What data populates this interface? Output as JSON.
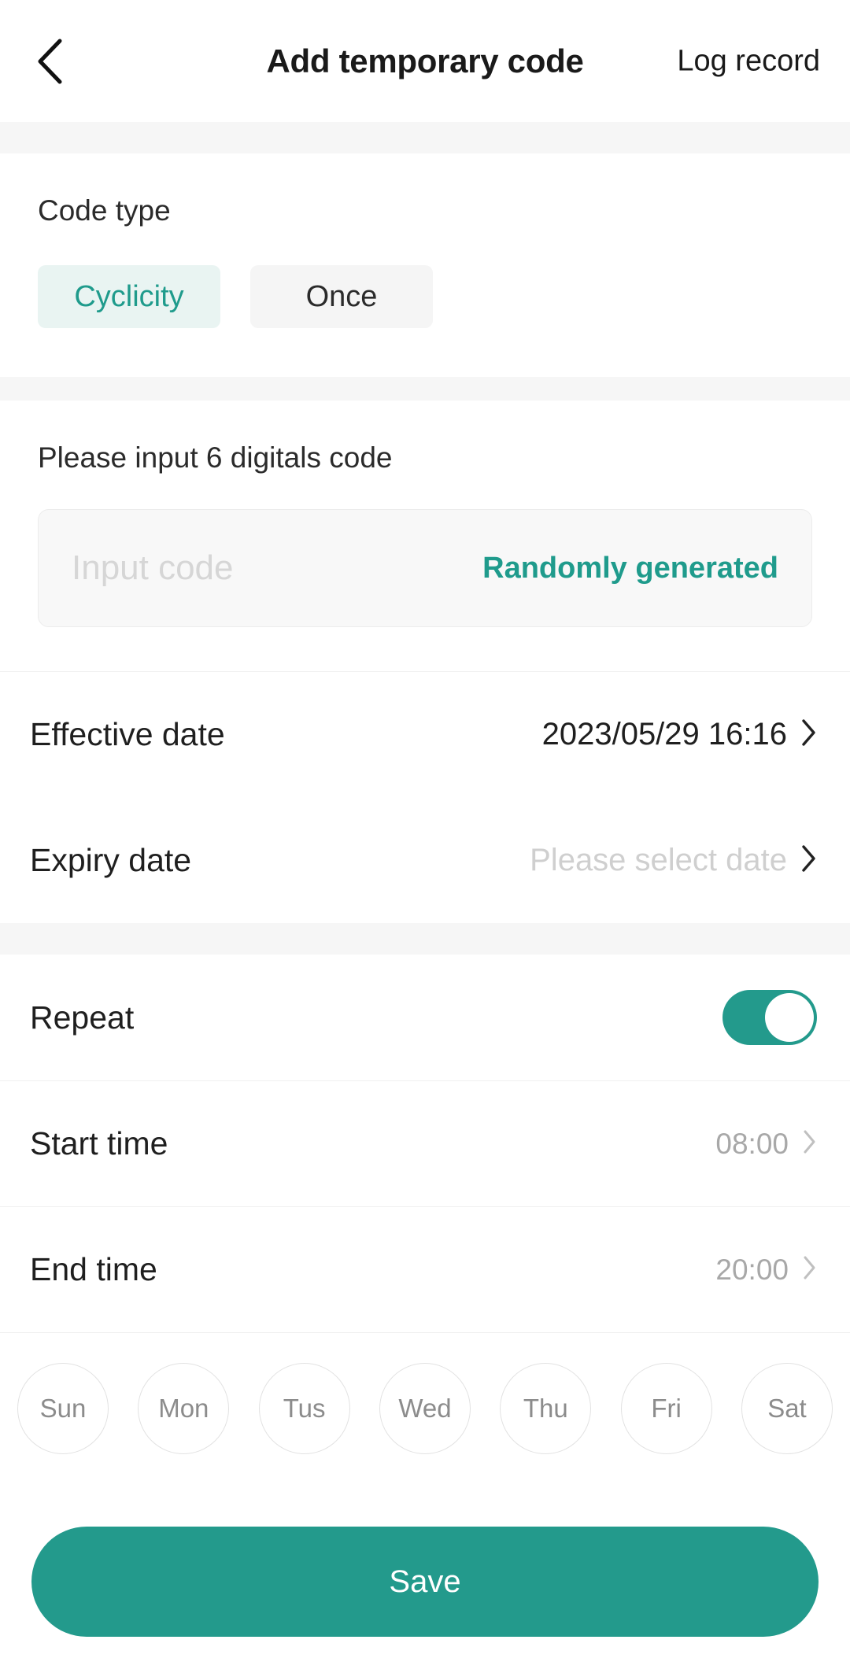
{
  "header": {
    "back_icon": "chevron-left-icon",
    "title": "Add temporary code",
    "action_label": "Log record"
  },
  "code_type": {
    "label": "Code type",
    "options": [
      {
        "label": "Cyclicity",
        "selected": true
      },
      {
        "label": "Once",
        "selected": false
      }
    ]
  },
  "code_input": {
    "label": "Please input 6 digitals code",
    "value": "",
    "placeholder": "Input code",
    "random_label": "Randomly generated"
  },
  "dates": [
    {
      "label": "Effective date",
      "value": "2023/05/29 16:16",
      "is_placeholder": false
    },
    {
      "label": "Expiry date",
      "value": "Please select date",
      "is_placeholder": true
    }
  ],
  "repeat": {
    "label": "Repeat",
    "enabled": true
  },
  "times": [
    {
      "label": "Start time",
      "value": "08:00"
    },
    {
      "label": "End time",
      "value": "20:00"
    }
  ],
  "days": [
    {
      "label": "Sun",
      "selected": false
    },
    {
      "label": "Mon",
      "selected": false
    },
    {
      "label": "Tus",
      "selected": false
    },
    {
      "label": "Wed",
      "selected": false
    },
    {
      "label": "Thu",
      "selected": false
    },
    {
      "label": "Fri",
      "selected": false
    },
    {
      "label": "Sat",
      "selected": false
    }
  ],
  "footer": {
    "save_label": "Save"
  },
  "colors": {
    "accent": "#239a8c",
    "accent_soft_bg": "#e9f4f2",
    "chip_bg": "#f5f5f5",
    "band": "#f6f6f6",
    "placeholder": "#cfcfcf"
  }
}
